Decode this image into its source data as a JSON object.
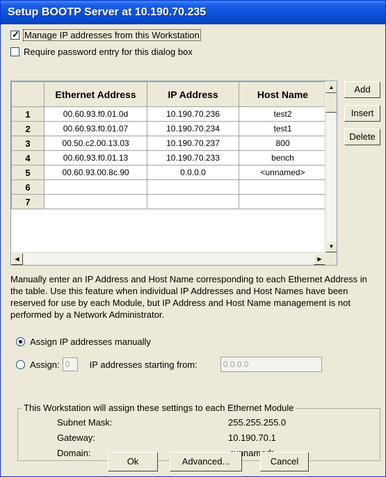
{
  "window": {
    "title": "Setup BOOTP Server at 10.190.70.235"
  },
  "options": {
    "manage": {
      "label": "Manage IP addresses from this Workstation",
      "checked": true
    },
    "password": {
      "label": "Require password entry for this dialog box",
      "checked": false
    }
  },
  "table": {
    "columns": [
      "Ethernet Address",
      "IP Address",
      "Host Name"
    ],
    "rows": [
      {
        "num": "1",
        "eth": "00.60.93.f0.01.0d",
        "ip": "10.190.70.236",
        "host": "test2"
      },
      {
        "num": "2",
        "eth": "00.60.93.f0.01.07",
        "ip": "10.190.70.234",
        "host": "test1"
      },
      {
        "num": "3",
        "eth": "00.50.c2.00.13.03",
        "ip": "10.190.70.237",
        "host": "800"
      },
      {
        "num": "4",
        "eth": "00.60.93.f0.01.13",
        "ip": "10.190.70.233",
        "host": "bench"
      },
      {
        "num": "5",
        "eth": "00.60.93.00.8c.90",
        "ip": "0.0.0.0",
        "host": "<unnamed>"
      },
      {
        "num": "6",
        "eth": "",
        "ip": "",
        "host": ""
      },
      {
        "num": "7",
        "eth": "",
        "ip": "",
        "host": ""
      }
    ]
  },
  "side_buttons": {
    "add": "Add",
    "insert": "Insert",
    "delete": "Delete"
  },
  "help_text": "Manually enter an IP Address and Host Name corresponding to each Ethernet Address in the table.  Use this feature when individual IP Addresses and Host Names have been reserved for use by each Module, but IP Address and Host Name management is not performed by a Network Administrator.",
  "assign": {
    "manual_label": "Assign IP addresses manually",
    "manual_selected": true,
    "auto_label_prefix": "Assign:",
    "auto_count": "0",
    "auto_label_suffix": "IP addresses starting from:",
    "auto_start": "0.0.0.0"
  },
  "settings": {
    "title": "This Workstation will assign these settings to each Ethernet Module",
    "subnet_label": "Subnet Mask:",
    "subnet_value": "255.255.255.0",
    "gateway_label": "Gateway:",
    "gateway_value": "10.190.70.1",
    "domain_label": "Domain:",
    "domain_value": "<unnamed>"
  },
  "buttons": {
    "ok": "Ok",
    "advanced": "Advanced...",
    "cancel": "Cancel"
  }
}
